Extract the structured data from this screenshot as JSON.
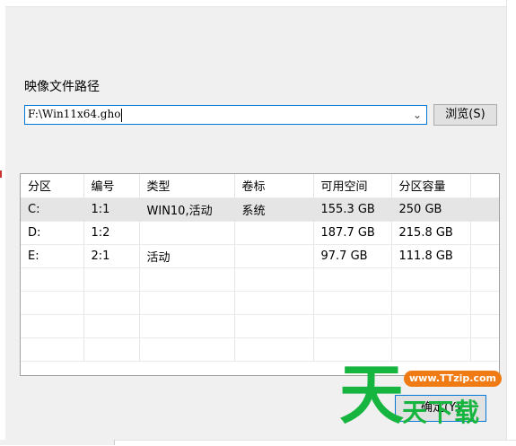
{
  "image_path": {
    "label": "映像文件路径",
    "value": "F:\\Win11x64.gho"
  },
  "browse_button": "浏览(S)",
  "partitions": {
    "columns": [
      "分区",
      "编号",
      "类型",
      "卷标",
      "可用空间",
      "分区容量"
    ],
    "rows": [
      [
        "C:",
        "1:1",
        "WIN10,活动",
        "系统",
        "155.3 GB",
        "250 GB"
      ],
      [
        "D:",
        "1:2",
        "",
        "",
        "187.7 GB",
        "215.8 GB"
      ],
      [
        "E:",
        "2:1",
        "活动",
        "",
        "97.7 GB",
        "111.8 GB"
      ]
    ],
    "selected_row": 0
  },
  "confirm_button": "确定(Y)",
  "watermark": {
    "char": "天",
    "url": "www.TTzip.com",
    "name": "天下载"
  }
}
